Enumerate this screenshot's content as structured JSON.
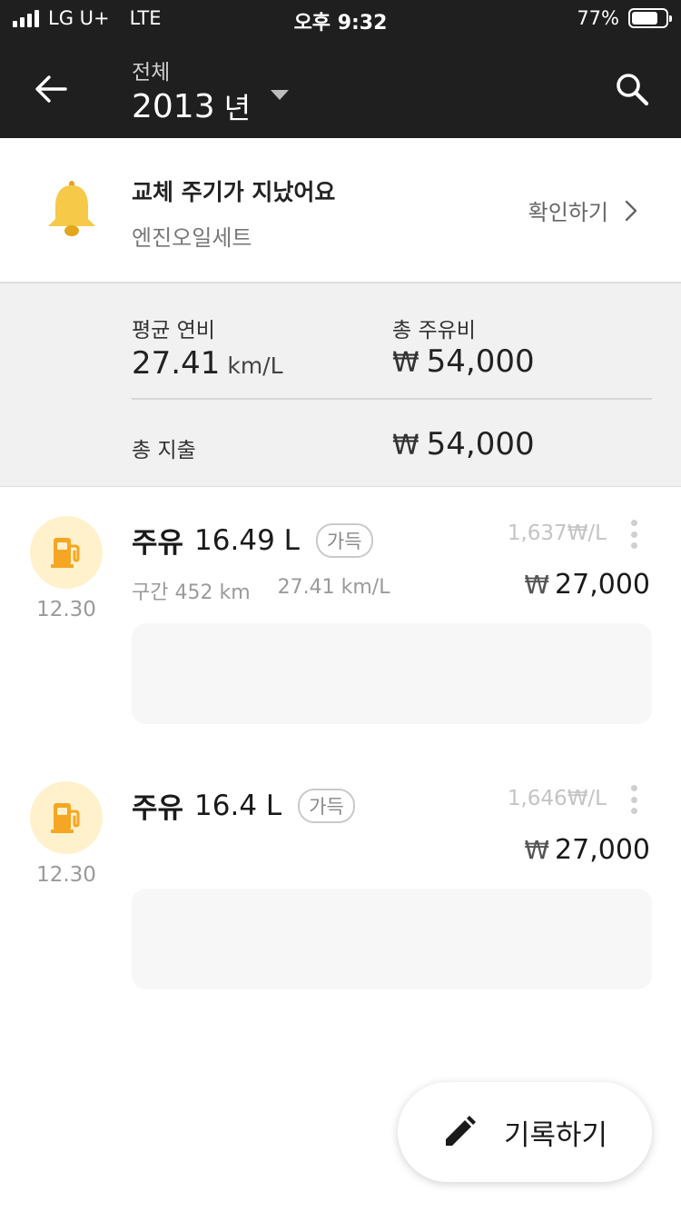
{
  "status_bar": {
    "carrier": "LG U+",
    "network": "LTE",
    "time": "오후 9:32",
    "battery": "77%",
    "battery_level": 0.77
  },
  "app_bar": {
    "subtitle": "전체",
    "year": "2013",
    "year_suffix": "년",
    "icons": [
      "back-arrow-icon",
      "dropdown-triangle-icon",
      "search-icon"
    ]
  },
  "reminder": {
    "title": "교체 주기가 지났어요",
    "item": "엔진오일세트",
    "action": "확인하기",
    "icon": "bell-icon",
    "icon_color": "#f7c948"
  },
  "summary": {
    "avg_efficiency_label": "평균 연비",
    "avg_efficiency_value": "27.41",
    "avg_efficiency_unit": "km/L",
    "total_fuel_cost_label": "총 주유비",
    "total_fuel_cost_value": "54,000",
    "total_expense_label": "총 지출",
    "total_expense_value": "54,000",
    "currency_symbol": "₩"
  },
  "records": [
    {
      "kind": "주유",
      "amount": "16.49 L",
      "badge": "가득",
      "unit_price": "1,637₩/L",
      "section_label": "구간 452 km",
      "efficiency": "27.41 km/L",
      "total": "27,000",
      "date": "12.30"
    },
    {
      "kind": "주유",
      "amount": "16.4 L",
      "badge": "가득",
      "unit_price": "1,646₩/L",
      "total": "27,000",
      "date": "12.30"
    }
  ],
  "fab": {
    "label": "기록하기",
    "icon": "pencil-icon"
  },
  "colors": {
    "header_bg": "#1f1f1f",
    "summary_bg": "#f1f1f1",
    "fuel_icon": "#f5a623",
    "fuel_icon_bg": "#fff1cc"
  }
}
